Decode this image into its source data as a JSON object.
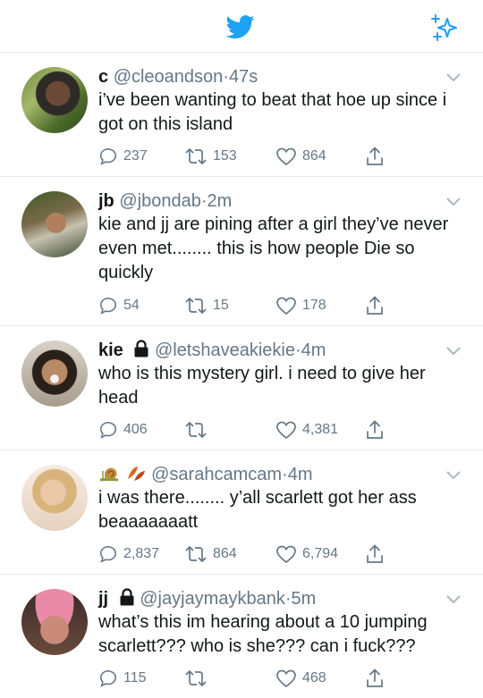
{
  "tweets": [
    {
      "name": "c",
      "handle": "@cleoandson",
      "sep": "·",
      "time": "47s",
      "locked": false,
      "emoji": false,
      "text": "i’ve been wanting to beat that hoe up since i got on this island",
      "replies": "237",
      "retweets": "153",
      "likes": "864"
    },
    {
      "name": "jb",
      "handle": "@jbondab",
      "sep": "·",
      "time": "2m",
      "locked": false,
      "emoji": false,
      "text": "kie and jj are pining after a girl they’ve never even met........ this is how people Die so quickly",
      "replies": "54",
      "retweets": "15",
      "likes": "178"
    },
    {
      "name": "kie",
      "handle": "@letshaveakiekie",
      "sep": "·",
      "time": "4m",
      "locked": true,
      "emoji": false,
      "text": "who is this mystery girl. i need to give her head",
      "replies": "406",
      "retweets": "",
      "likes": "4,381"
    },
    {
      "name": "",
      "handle": "@sarahcamcam",
      "sep": "·",
      "time": "4m",
      "locked": false,
      "emoji": true,
      "text": "i was there........ y’all scarlett got her ass beaaaaaaatt",
      "replies": "2,837",
      "retweets": "864",
      "likes": "6,794"
    },
    {
      "name": "jj",
      "handle": "@jayjaymaykbank",
      "sep": "·",
      "time": "5m",
      "locked": true,
      "emoji": false,
      "text": "what’s this im hearing about a 10 jumping scarlett??? who is she??? can i fuck???",
      "replies": "115",
      "retweets": "",
      "likes": "468"
    }
  ],
  "colors": {
    "brand": "#1da1f2",
    "muted": "#657786",
    "text": "#14171a",
    "divider": "#e6ecf0"
  },
  "icons": {
    "header_logo": "twitter-bird-icon",
    "header_right": "sparkle-icon",
    "reply": "reply-icon",
    "retweet": "retweet-icon",
    "like": "heart-icon",
    "share": "share-icon",
    "more": "chevron-down-icon",
    "lock": "lock-icon"
  }
}
